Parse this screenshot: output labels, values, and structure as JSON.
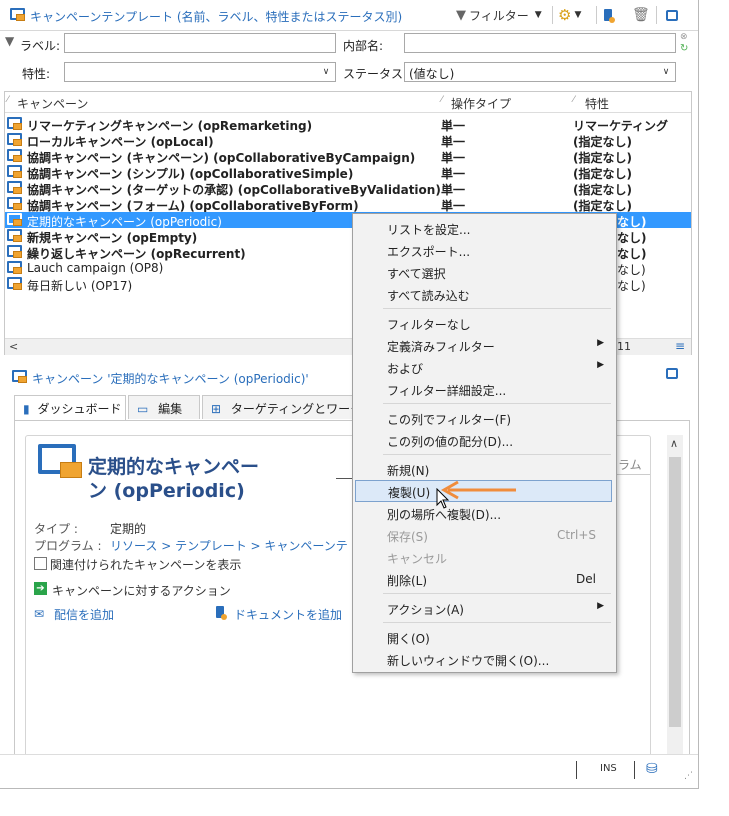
{
  "toolbar": {
    "title": "キャンペーンテンプレート (名前、ラベル、特性またはステータス別)",
    "filter_label": "フィルター"
  },
  "filters": {
    "label_label": "ラベル:",
    "internal_name_label": "内部名:",
    "nature_label": "特性:",
    "status_label": "ステータス:",
    "status_value": "(値なし)"
  },
  "grid": {
    "columns": [
      "キャンペーン",
      "操作タイプ",
      "特性"
    ],
    "rows": [
      {
        "name": "リマーケティングキャンペーン (opRemarketing)",
        "type": "単一",
        "nature": "リマーケティング",
        "bold": true
      },
      {
        "name": "ローカルキャンペーン (opLocal)",
        "type": "単一",
        "nature": "(指定なし)",
        "bold": true
      },
      {
        "name": "協調キャンペーン (キャンペーン) (opCollaborativeByCampaign)",
        "type": "単一",
        "nature": "(指定なし)",
        "bold": true
      },
      {
        "name": "協調キャンペーン (シンプル) (opCollaborativeSimple)",
        "type": "単一",
        "nature": "(指定なし)",
        "bold": true
      },
      {
        "name": "協調キャンペーン (ターゲットの承認) (opCollaborativeByValidation)",
        "type": "単一",
        "nature": "(指定なし)",
        "bold": true
      },
      {
        "name": "協調キャンペーン (フォーム) (opCollaborativeByForm)",
        "type": "単一",
        "nature": "(指定なし)",
        "bold": true
      },
      {
        "name": "定期的なキャンペーン (opPeriodic)",
        "type": "",
        "nature": "なし)",
        "bold": true
      },
      {
        "name": "新規キャンペーン (opEmpty)",
        "type": "",
        "nature": "なし)",
        "bold": true
      },
      {
        "name": "繰り返しキャンペーン (opRecurrent)",
        "type": "",
        "nature": "なし)",
        "bold": true
      },
      {
        "name": "Lauch campaign (OP8)",
        "type": "",
        "nature": "なし)",
        "bold": false
      },
      {
        "name": "毎日新しい (OP17)",
        "type": "",
        "nature": "なし)",
        "bold": false
      }
    ],
    "count": "11"
  },
  "detail": {
    "header": "キャンペーン '定期的なキャンペーン (opPeriodic)'",
    "tabs": [
      "ダッシュボード",
      "編集",
      "ターゲティングとワークフ"
    ],
    "card_title_line1": "定期的なキャンペー",
    "card_title_line2": "ン (opPeriodic)",
    "card_right_hint": "ラム",
    "type_label": "タイプ :",
    "type_value": "定期的",
    "program_label": "プログラム :",
    "program_path": "リソース > テンプレート > キャンペーンテ",
    "show_related": "関連付けられたキャンペーンを表示",
    "actions_title": "キャンペーンに対するアクション",
    "add_delivery": "配信を追加",
    "add_document": "ドキュメントを追加"
  },
  "status": {
    "ins": "INS"
  },
  "context_menu": {
    "items": [
      {
        "label": "リストを設定...",
        "shortcut": "",
        "submenu": false,
        "disabled": false
      },
      {
        "label": "エクスポート...",
        "shortcut": "",
        "submenu": false,
        "disabled": false
      },
      {
        "label": "すべて選択",
        "shortcut": "",
        "submenu": false,
        "disabled": false
      },
      {
        "label": "すべて読み込む",
        "shortcut": "",
        "submenu": false,
        "disabled": false
      },
      {
        "label": "フィルターなし",
        "shortcut": "",
        "submenu": false,
        "disabled": false
      },
      {
        "label": "定義済みフィルター",
        "shortcut": "",
        "submenu": true,
        "disabled": false
      },
      {
        "label": "および",
        "shortcut": "",
        "submenu": true,
        "disabled": false
      },
      {
        "label": "フィルター詳細設定...",
        "shortcut": "",
        "submenu": false,
        "disabled": false
      },
      {
        "label": "この列でフィルター(F)",
        "shortcut": "",
        "submenu": false,
        "disabled": false
      },
      {
        "label": "この列の値の配分(D)...",
        "shortcut": "",
        "submenu": false,
        "disabled": false
      },
      {
        "label": "新規(N)",
        "shortcut": "",
        "submenu": false,
        "disabled": false
      },
      {
        "label": "複製(U)",
        "shortcut": "",
        "submenu": false,
        "disabled": false,
        "highlighted": true
      },
      {
        "label": "別の場所へ複製(D)...",
        "shortcut": "",
        "submenu": false,
        "disabled": false
      },
      {
        "label": "保存(S)",
        "shortcut": "Ctrl+S",
        "submenu": false,
        "disabled": true
      },
      {
        "label": "キャンセル",
        "shortcut": "",
        "submenu": false,
        "disabled": true
      },
      {
        "label": "削除(L)",
        "shortcut": "Del",
        "submenu": false,
        "disabled": false
      },
      {
        "label": "アクション(A)",
        "shortcut": "",
        "submenu": true,
        "disabled": false
      },
      {
        "label": "開く(O)",
        "shortcut": "",
        "submenu": false,
        "disabled": false
      },
      {
        "label": "新しいウィンドウで開く(O)...",
        "shortcut": "",
        "submenu": false,
        "disabled": false
      }
    ]
  },
  "colors": {
    "accent": "#2a6ebb",
    "selection": "#3399ff",
    "arrow": "#f08c3c",
    "menu_highlight": "#dce9f8"
  }
}
